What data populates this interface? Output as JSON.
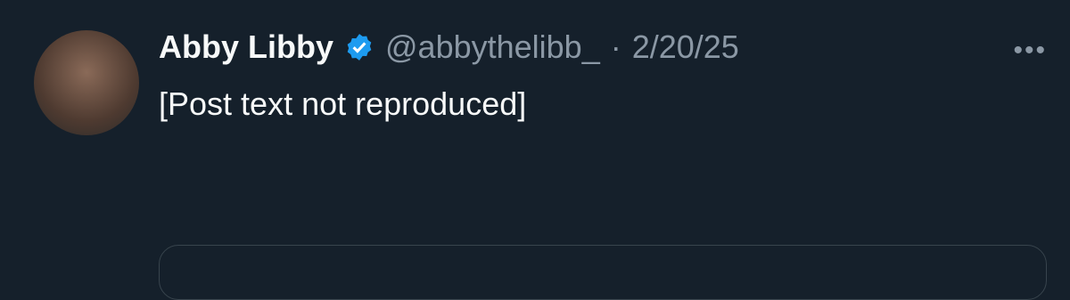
{
  "author": {
    "name": "Abby Libby",
    "handle": "@abbythelibb_",
    "date": "2/20/25",
    "verified_icon": "verified-badge-icon"
  },
  "tweet": {
    "text": "[Post text not reproduced]"
  },
  "more_icon": "more-options-icon",
  "colors": {
    "background": "#15202b",
    "badge": "#1d9bf0",
    "secondary_text": "#8b98a5"
  }
}
